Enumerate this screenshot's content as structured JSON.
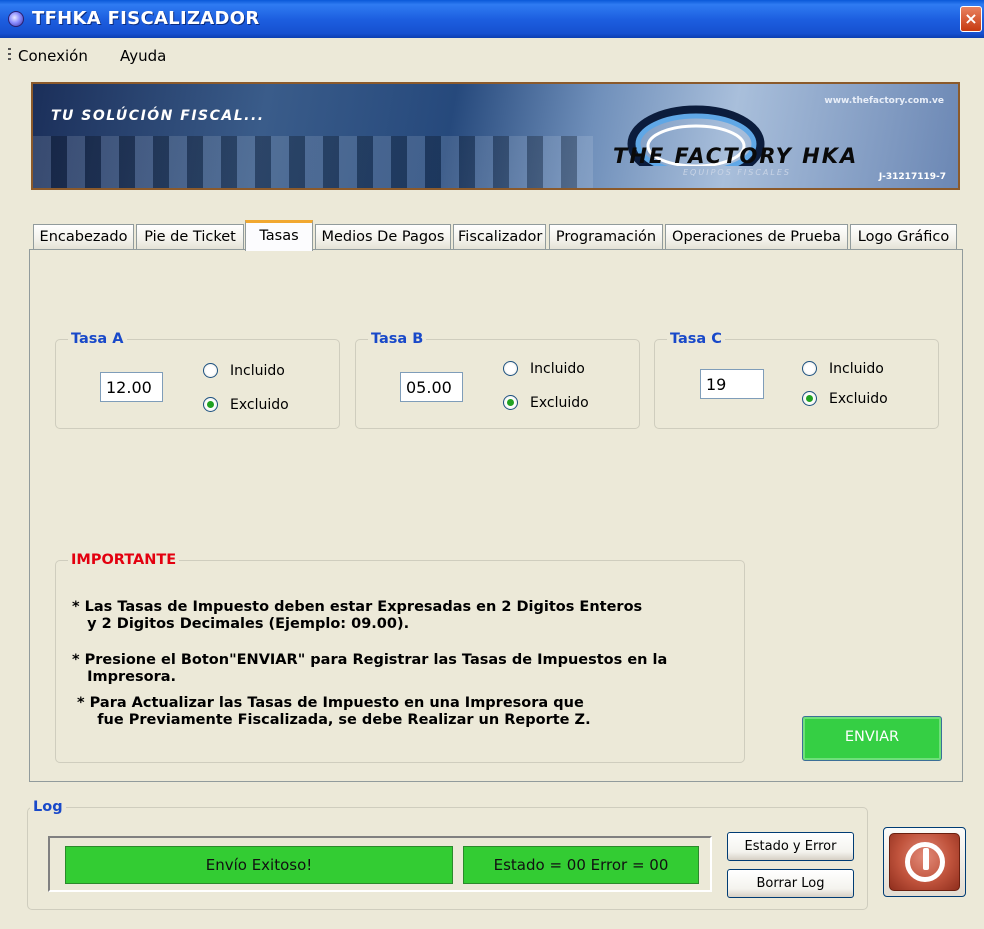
{
  "window": {
    "title": "TFHKA  FISCALIZADOR",
    "close_glyph": "×"
  },
  "menu": {
    "items": [
      "Conexión",
      "Ayuda"
    ]
  },
  "banner": {
    "tagline": "TU SOLÚCIÓN FISCAL...",
    "url": "www.thefactory.com.ve",
    "brand": "THE FACTORY HKA",
    "brand_sub": "EQUIPOS FISCALES",
    "rif": "J-31217119-7"
  },
  "tabs": {
    "items": [
      "Encabezado",
      "Pie de Ticket",
      "Tasas",
      "Medios De Pagos",
      "Fiscalizador",
      "Programación",
      "Operaciones de Prueba",
      "Logo Gráfico"
    ],
    "active": "Tasas"
  },
  "tasas": {
    "a": {
      "title": "Tasa A",
      "value": "12.00",
      "incluido": "Incluido",
      "excluido": "Excluido",
      "selected": "excluido"
    },
    "b": {
      "title": "Tasa B",
      "value": "05.00",
      "incluido": "Incluido",
      "excluido": "Excluido",
      "selected": "excluido"
    },
    "c": {
      "title": "Tasa C",
      "value": "19",
      "incluido": "Incluido",
      "excluido": "Excluido",
      "selected": "excluido"
    }
  },
  "importante": {
    "title": "IMPORTANTE",
    "note1": "* Las Tasas de Impuesto deben estar Expresadas en 2 Digitos Enteros\n   y 2 Digitos Decimales (Ejemplo: 09.00).",
    "note2": "* Presione el Boton\"ENVIAR\" para Registrar las Tasas de Impuestos en la\n   Impresora.",
    "note3": " * Para Actualizar las Tasas de Impuesto en una Impresora que\n     fue Previamente Fiscalizada, se debe Realizar un Reporte Z."
  },
  "buttons": {
    "enviar": "ENVIAR",
    "estado_error": "Estado y Error",
    "borrar_log": "Borrar Log"
  },
  "log": {
    "title": "Log",
    "message": "Envío Exitoso!",
    "status": "Estado = 00   Error = 00"
  },
  "colors": {
    "group_title": "#1949c9",
    "important": "#e3000f",
    "success_green": "#33cc33",
    "enviar_green": "#35cf44",
    "active_tab_accent": "#f1a830"
  },
  "icons": {
    "app": "app-round-icon",
    "power": "power-icon",
    "close": "close-icon"
  }
}
